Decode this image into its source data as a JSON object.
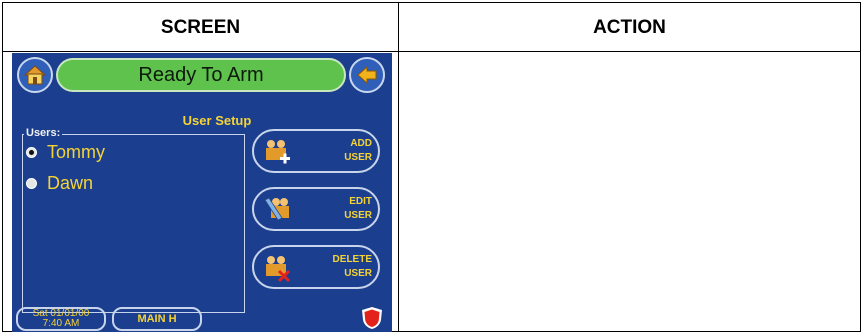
{
  "table": {
    "col_screen": "SCREEN",
    "col_action": "ACTION"
  },
  "device": {
    "status": "Ready To Arm",
    "title": "User Setup",
    "users_label": "Users:",
    "users": [
      {
        "name": "Tommy",
        "selected": true
      },
      {
        "name": "Dawn",
        "selected": false
      }
    ],
    "buttons": {
      "add": "ADD\nUSER",
      "edit": "EDIT\nUSER",
      "delete": "DELETE\nUSER"
    },
    "date_line1": "Sat 01/01/00",
    "date_line2": "7:40 AM",
    "main_label": "MAIN H",
    "icons": {
      "home": "home-icon",
      "back": "back-arrow-icon",
      "add_user": "add-user-icon",
      "edit_user": "edit-user-icon",
      "delete_user": "delete-user-icon",
      "emergency": "emergency-shield-icon"
    },
    "colors": {
      "screen_bg": "#1b3f8e",
      "status_bar": "#5ec24d",
      "text_accent": "#f5d335"
    }
  }
}
